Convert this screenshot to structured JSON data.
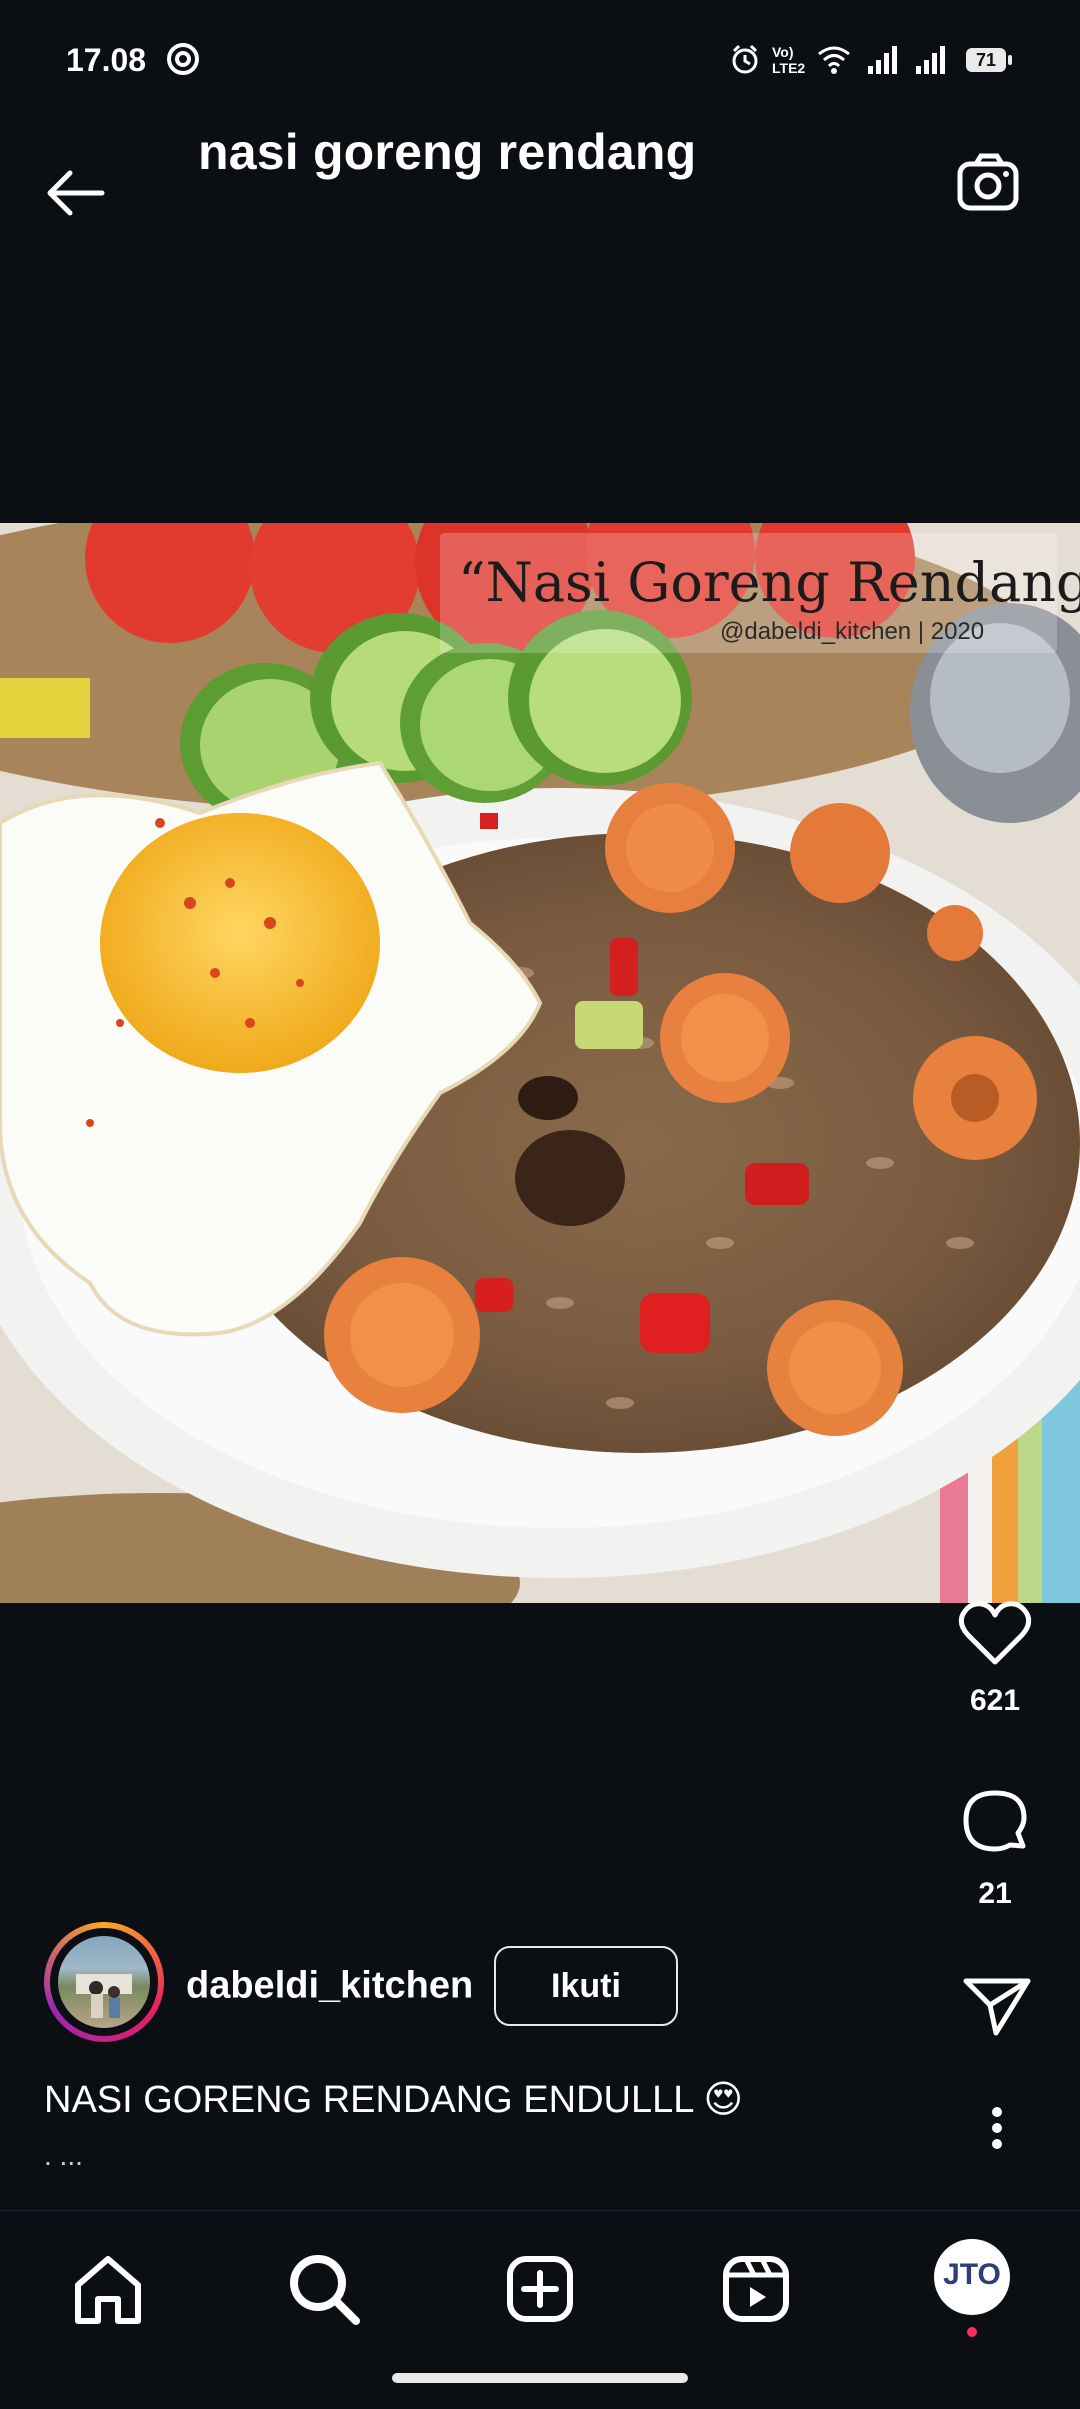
{
  "status_bar": {
    "time": "17.08",
    "network_label": "Vo) LTE2",
    "battery": "71"
  },
  "header": {
    "title": "nasi goreng rendang"
  },
  "post": {
    "overlay_title": "“Nasi Goreng Rendang“",
    "overlay_credit": "@dabeldi_kitchen | 2020",
    "likes": "621",
    "comments": "21"
  },
  "author": {
    "username": "dabeldi_kitchen",
    "follow_label": "Ikuti"
  },
  "caption": {
    "text": "NASI GORENG RENDANG ENDULLL 😍",
    "more": ". ..."
  },
  "nav": {
    "profile_initials": "JTO"
  },
  "colors": {
    "background": "#0b0f14",
    "notification_dot": "#ff2d55"
  }
}
